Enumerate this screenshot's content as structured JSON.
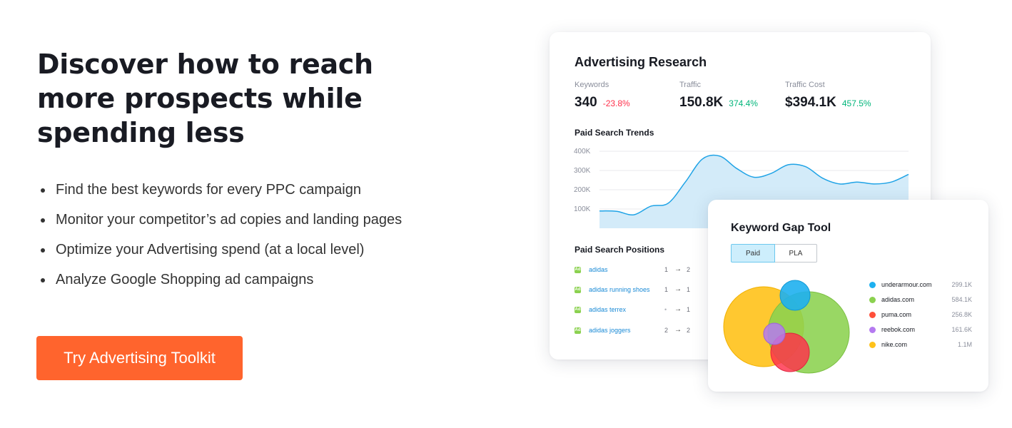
{
  "hero": {
    "headline": "Discover how to reach more prospects while spending less",
    "bullets": [
      "Find the best keywords for every PPC campaign",
      "Monitor your competitor’s ad copies and landing pages",
      "Optimize your Advertising spend (at a local level)",
      "Analyze Google Shopping ad campaigns"
    ],
    "cta_label": "Try Advertising Toolkit"
  },
  "advertising_card": {
    "title": "Advertising Research",
    "metrics": [
      {
        "label": "Keywords",
        "value": "340",
        "change": "-23.8%",
        "trend": "negative"
      },
      {
        "label": "Traffic",
        "value": "150.8K",
        "change": "374.4%",
        "trend": "positive"
      },
      {
        "label": "Traffic Cost",
        "value": "$394.1K",
        "change": "457.5%",
        "trend": "positive"
      }
    ],
    "trends_title": "Paid Search Trends",
    "positions_title": "Paid Search Positions",
    "positions": [
      {
        "badge": "Ad",
        "keyword": "adidas",
        "from": "1",
        "to": "2"
      },
      {
        "badge": "Ad",
        "keyword": "adidas running shoes",
        "from": "1",
        "to": "1"
      },
      {
        "badge": "Ad",
        "keyword": "adidas terrex",
        "from": "•",
        "to": "1"
      },
      {
        "badge": "Ad",
        "keyword": "adidas joggers",
        "from": "2",
        "to": "2"
      }
    ],
    "arrow_glyph": "→"
  },
  "keyword_gap_card": {
    "title": "Keyword Gap Tool",
    "tabs": [
      {
        "label": "Paid",
        "active": true
      },
      {
        "label": "PLA",
        "active": false
      }
    ],
    "legend": [
      {
        "domain": "underarmour.com",
        "value": "299.1K",
        "color": "#1eb0f0"
      },
      {
        "domain": "adidas.com",
        "value": "584.1K",
        "color": "#8bd14f"
      },
      {
        "domain": "puma.com",
        "value": "256.8K",
        "color": "#ff4f3a"
      },
      {
        "domain": "reebok.com",
        "value": "161.6K",
        "color": "#b57af0"
      },
      {
        "domain": "nike.com",
        "value": "1.1M",
        "color": "#ffc21a"
      }
    ]
  },
  "colors": {
    "accent": "#ff642d",
    "link": "#1a8ad6",
    "negative": "#ff2f4a",
    "positive": "#00b57a",
    "chart_line": "#1fa3e6",
    "chart_fill": "#d3ebf9"
  },
  "chart_data": {
    "type": "area",
    "title": "Paid Search Trends",
    "xlabel": "",
    "ylabel": "",
    "yticks": [
      "400K",
      "300K",
      "200K",
      "100K"
    ],
    "ylim": [
      0,
      400000
    ],
    "grid": true,
    "series": [
      {
        "values": [
          90000,
          88000,
          70000,
          115000,
          130000,
          240000,
          360000,
          375000,
          310000,
          265000,
          285000,
          330000,
          320000,
          260000,
          230000,
          240000,
          230000,
          240000,
          280000
        ]
      }
    ]
  }
}
